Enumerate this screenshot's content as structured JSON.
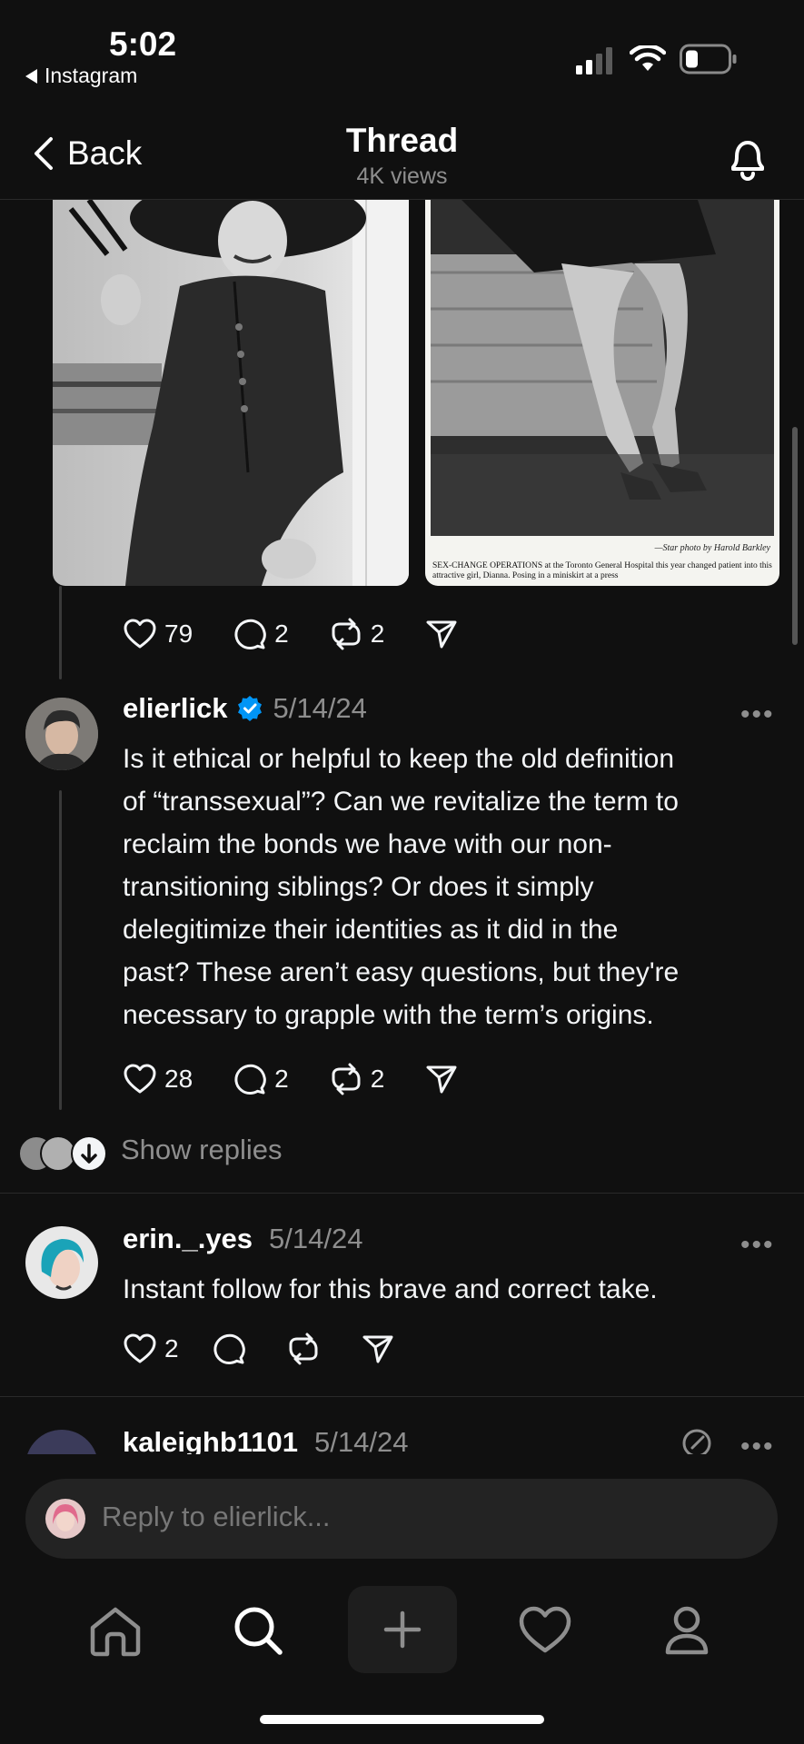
{
  "status_bar": {
    "time": "5:02",
    "back_app": "Instagram"
  },
  "header": {
    "back_label": "Back",
    "title": "Thread",
    "views": "4K views"
  },
  "media": {
    "caption_credit": "—Star photo by Harold Barkley",
    "caption_text": "SEX-CHANGE OPERATIONS at the Toronto General Hospital this year changed patient into this attractive girl, Dianna. Posing in a miniskirt at a press"
  },
  "top_post_actions": {
    "likes": "79",
    "comments": "2",
    "reposts": "2"
  },
  "main_post": {
    "username": "elierlick",
    "verified": true,
    "date": "5/14/24",
    "more": "•••",
    "lines": [
      "Is it ethical or helpful to keep the old definition",
      "of “transsexual”? Can we revitalize the term to",
      "reclaim the bonds we have with our non-",
      "transitioning siblings? Or does it simply",
      "delegitimize their identities as it did in the",
      "past? These aren’t easy questions, but they're",
      "necessary to grapple with the term’s origins."
    ],
    "likes": "28",
    "comments": "2",
    "reposts": "2",
    "show_replies": "Show replies"
  },
  "reply_1": {
    "username": "erin._.yes",
    "date": "5/14/24",
    "more": "•••",
    "text": "Instant follow for this brave and correct take.",
    "likes": "2"
  },
  "reply_2": {
    "username": "kaleighb1101",
    "date": "5/14/24",
    "more": "•••"
  },
  "composer": {
    "placeholder": "Reply to elierlick..."
  },
  "colors": {
    "background": "#101010",
    "verified": "#0095f6",
    "muted": "#8e8e8e"
  },
  "icons": {
    "status": [
      "signal-icon",
      "wifi-icon",
      "battery-icon"
    ],
    "header": [
      "chevron-left-icon",
      "bell-icon"
    ],
    "actions": [
      "heart-icon",
      "comment-icon",
      "repost-icon",
      "share-icon"
    ],
    "nav": [
      "home-icon",
      "search-icon",
      "plus-icon",
      "heart-icon",
      "profile-icon"
    ]
  }
}
